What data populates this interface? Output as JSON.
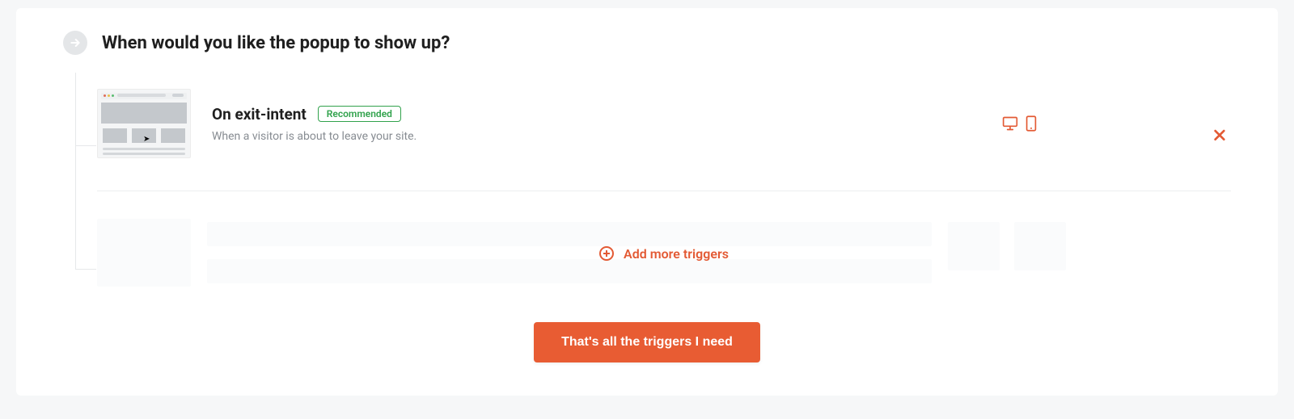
{
  "heading": "When would you like the popup to show up?",
  "trigger": {
    "title": "On exit-intent",
    "badge": "Recommended",
    "description": "When a visitor is about to leave your site."
  },
  "icons": {
    "step": "arrow-right-circle-icon",
    "desktop": "desktop-icon",
    "mobile": "mobile-icon",
    "delete": "close-icon",
    "add": "plus-circle-icon"
  },
  "actions": {
    "add_more": "Add more triggers",
    "done": "That's all the triggers I need"
  },
  "colors": {
    "accent": "#e35a34",
    "success": "#31a24c"
  }
}
